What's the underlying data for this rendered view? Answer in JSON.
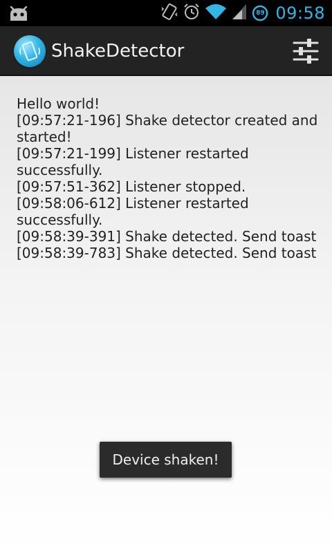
{
  "status_bar": {
    "time": "09:58",
    "battery_level": "89",
    "icons": [
      "cyanogen-icon",
      "vibrate-icon",
      "alarm-icon",
      "wifi-icon",
      "signal-icon",
      "battery-icon"
    ],
    "accent_color": "#33b5e5"
  },
  "action_bar": {
    "title": "ShakeDetector",
    "menu_icon": "settings-sliders-icon"
  },
  "log": {
    "lines": [
      "Hello world!",
      "[09:57:21-196] Shake detector created and started!",
      "[09:57:21-199] Listener restarted successfully.",
      "[09:57:51-362] Listener stopped.",
      "[09:58:06-612] Listener restarted successfully.",
      "[09:58:39-391] Shake detected. Send toast",
      "[09:58:39-783] Shake detected. Send toast"
    ]
  },
  "toast": {
    "message": "Device shaken!"
  }
}
